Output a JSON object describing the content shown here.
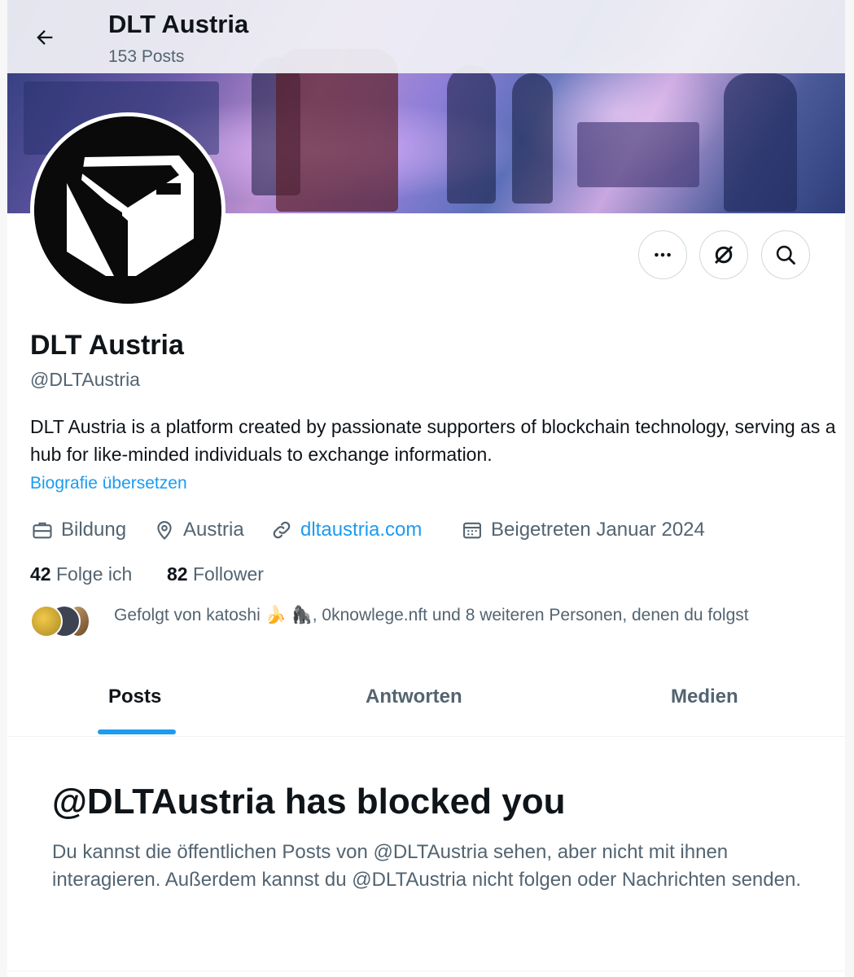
{
  "header": {
    "title": "DLT Austria",
    "posts_count": "153 Posts",
    "back_icon": "arrow-left-icon"
  },
  "profile": {
    "name": "DLT Austria",
    "handle": "@DLTAustria",
    "bio": "DLT Austria is a platform created by passionate supporters of blockchain technology, serving as a hub for like-minded individuals to exchange information.",
    "translate_link": "Biografie übersetzen",
    "category": "Bildung",
    "location": "Austria",
    "website": "dltaustria.com",
    "joined": "Beigetreten Januar 2024",
    "following_count": "42",
    "following_label": "Folge ich",
    "followers_count": "82",
    "followers_label": "Follower",
    "followed_by": "Gefolgt von katoshi 🍌 🦍, 0knowlege.nft und 8 weiteren Personen, denen du folgst"
  },
  "tabs": [
    {
      "label": "Posts",
      "active": true
    },
    {
      "label": "Antworten",
      "active": false
    },
    {
      "label": "Medien",
      "active": false
    }
  ],
  "blocked": {
    "title": "@DLTAustria has blocked you",
    "message": "Du kannst die öffentlichen Posts von @DLTAustria sehen, aber nicht mit ihnen interagieren. Außerdem kannst du @DLTAustria nicht folgen oder Nachrichten senden."
  },
  "colors": {
    "accent": "#1d9bf0",
    "text_primary": "#0f1419",
    "text_secondary": "#536471"
  }
}
